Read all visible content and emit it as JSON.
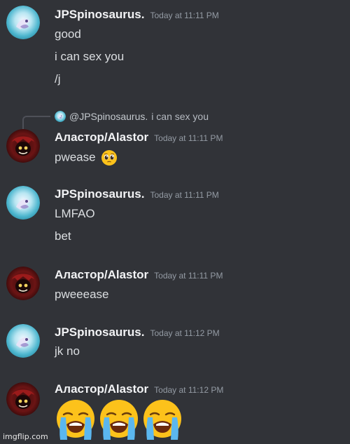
{
  "users": {
    "jp": {
      "name": "JPSpinosaurus.",
      "avatar_color": "#5bc3d6"
    },
    "alastor": {
      "name": "Аластор/Alastor",
      "avatar_color": "#7a1616"
    }
  },
  "messages": [
    {
      "author": "JPSpinosaurus.",
      "timestamp": "Today at 11:11 PM",
      "lines": [
        "good",
        "i can sex you",
        "/j"
      ]
    },
    {
      "author": "Аластор/Alastor",
      "timestamp": "Today at 11:11 PM",
      "reply_to": {
        "author": "@JPSpinosaurus.",
        "text": "i can sex you"
      },
      "lines": [
        "pwease"
      ],
      "emoji": "pleading-face"
    },
    {
      "author": "JPSpinosaurus.",
      "timestamp": "Today at 11:11 PM",
      "lines": [
        "LMFAO",
        "bet"
      ]
    },
    {
      "author": "Аластор/Alastor",
      "timestamp": "Today at 11:11 PM",
      "lines": [
        "pweeease"
      ]
    },
    {
      "author": "JPSpinosaurus.",
      "timestamp": "Today at 11:12 PM",
      "lines": [
        "jk no"
      ]
    },
    {
      "author": "Аластор/Alastor",
      "timestamp": "Today at 11:12 PM",
      "lines": [],
      "emoji": "loudly-crying-face x3"
    }
  ],
  "watermark": "imgflip.com",
  "colors": {
    "background": "#313338",
    "author_text": "#f2f3f5",
    "timestamp_text": "#949ba4",
    "body_text": "#dbdee1"
  }
}
